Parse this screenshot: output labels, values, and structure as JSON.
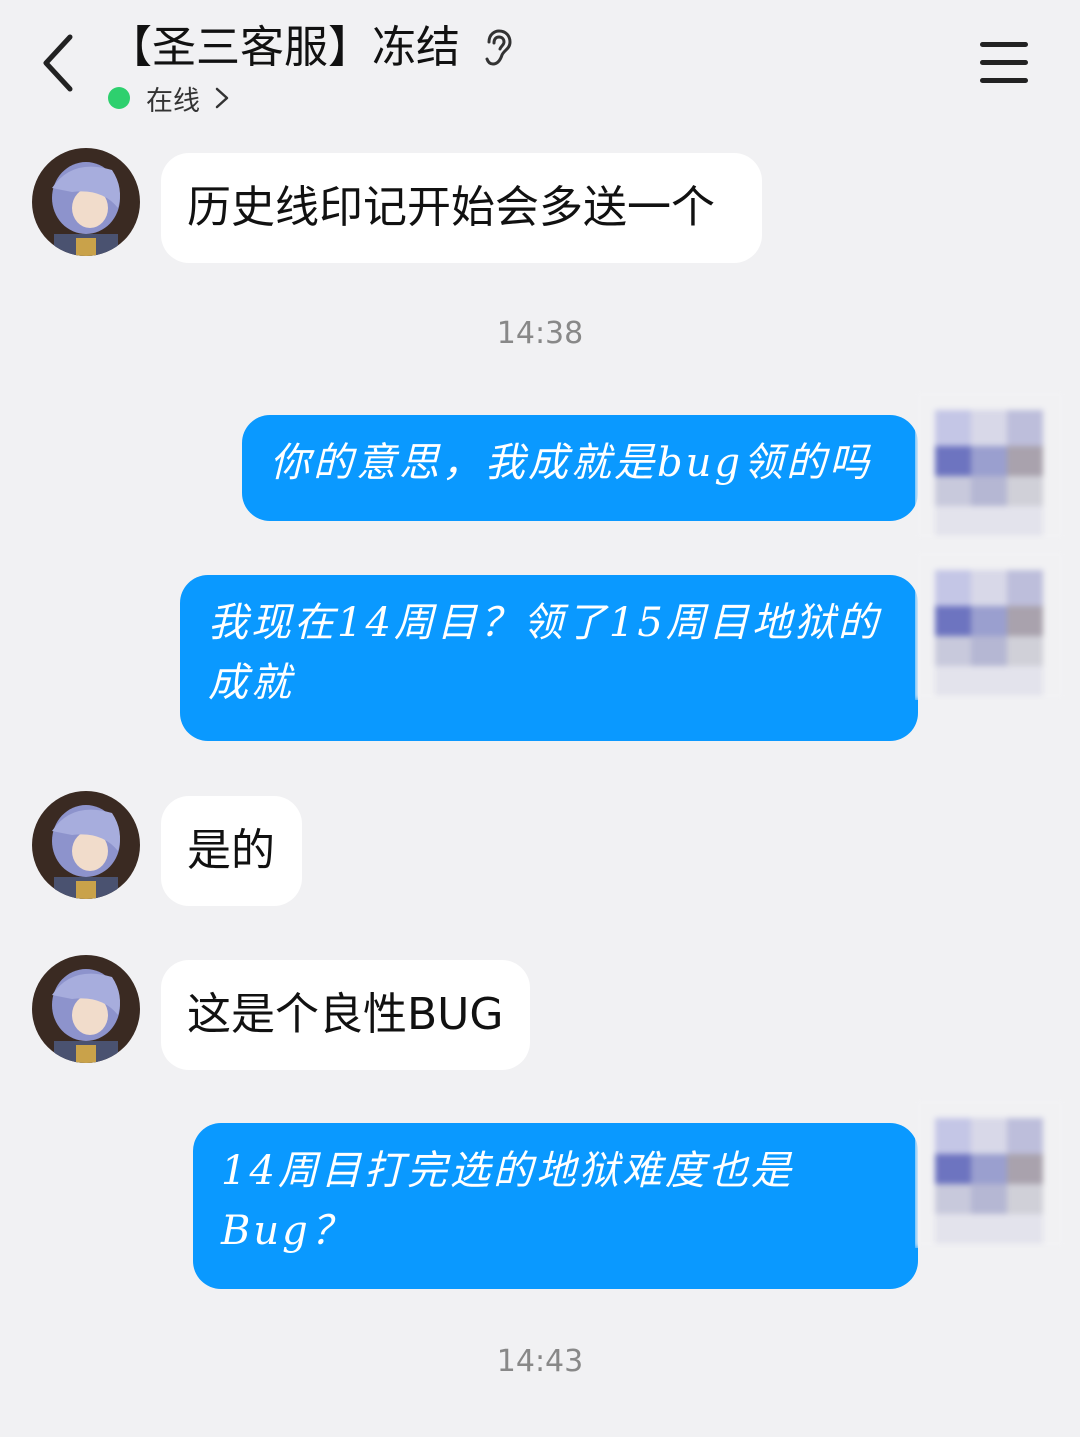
{
  "header": {
    "title": "【圣三客服】冻结",
    "status": "在线",
    "status_color": "#2ed06e"
  },
  "icons": {
    "back": "back-chevron-icon",
    "ear": "ear-icon",
    "status_chevron": "chevron-right-icon",
    "menu": "menu-icon"
  },
  "colors": {
    "background": "#f1f1f3",
    "incoming_bubble": "#ffffff",
    "outgoing_bubble": "#0a99ff"
  },
  "messages": [
    {
      "side": "incoming",
      "text": "历史线印记开始会多送一个"
    },
    {
      "type": "time",
      "text": "14:38"
    },
    {
      "side": "outgoing",
      "text": "你的意思，我成就是bug领的吗"
    },
    {
      "side": "outgoing",
      "text": "我现在14周目？领了15周目地狱的成就"
    },
    {
      "side": "incoming",
      "text": "是的"
    },
    {
      "side": "incoming",
      "text": "这是个良性BUG"
    },
    {
      "side": "outgoing",
      "text": "14周目打完选的地狱难度也是Bug？"
    },
    {
      "type": "time",
      "text": "14:43"
    }
  ]
}
